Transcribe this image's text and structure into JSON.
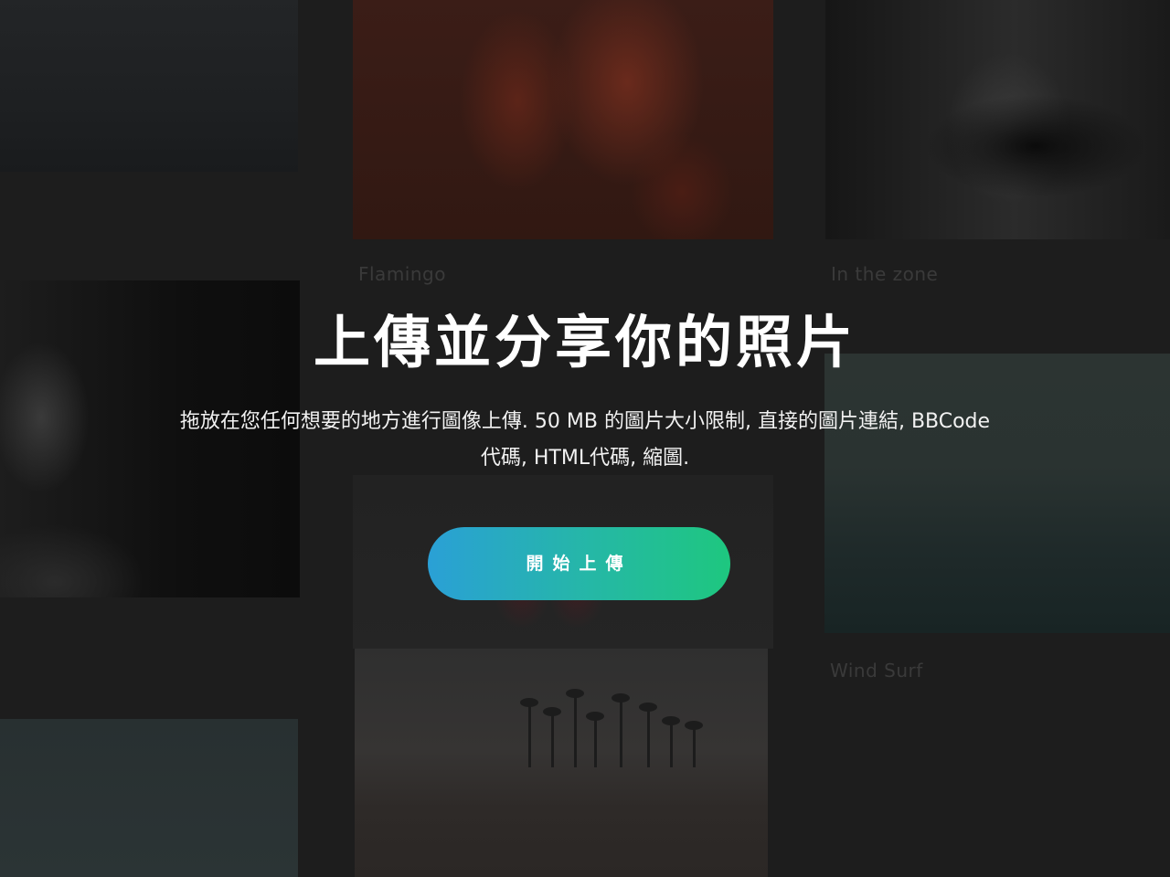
{
  "hero": {
    "title": "上傳並分享你的照片",
    "description": "拖放在您任何想要的地方進行圖像上傳. 50 MB 的圖片大小限制, 直接的圖片連結, BBCode代碼, HTML代碼, 縮圖.",
    "button_label": "開始上傳",
    "accent_gradient": [
      "#2aa0d6",
      "#1ec77f"
    ]
  },
  "gallery": {
    "captions": {
      "flamingo": "Flamingo",
      "camera": "In the zone",
      "surf": "Wind Surf"
    }
  }
}
